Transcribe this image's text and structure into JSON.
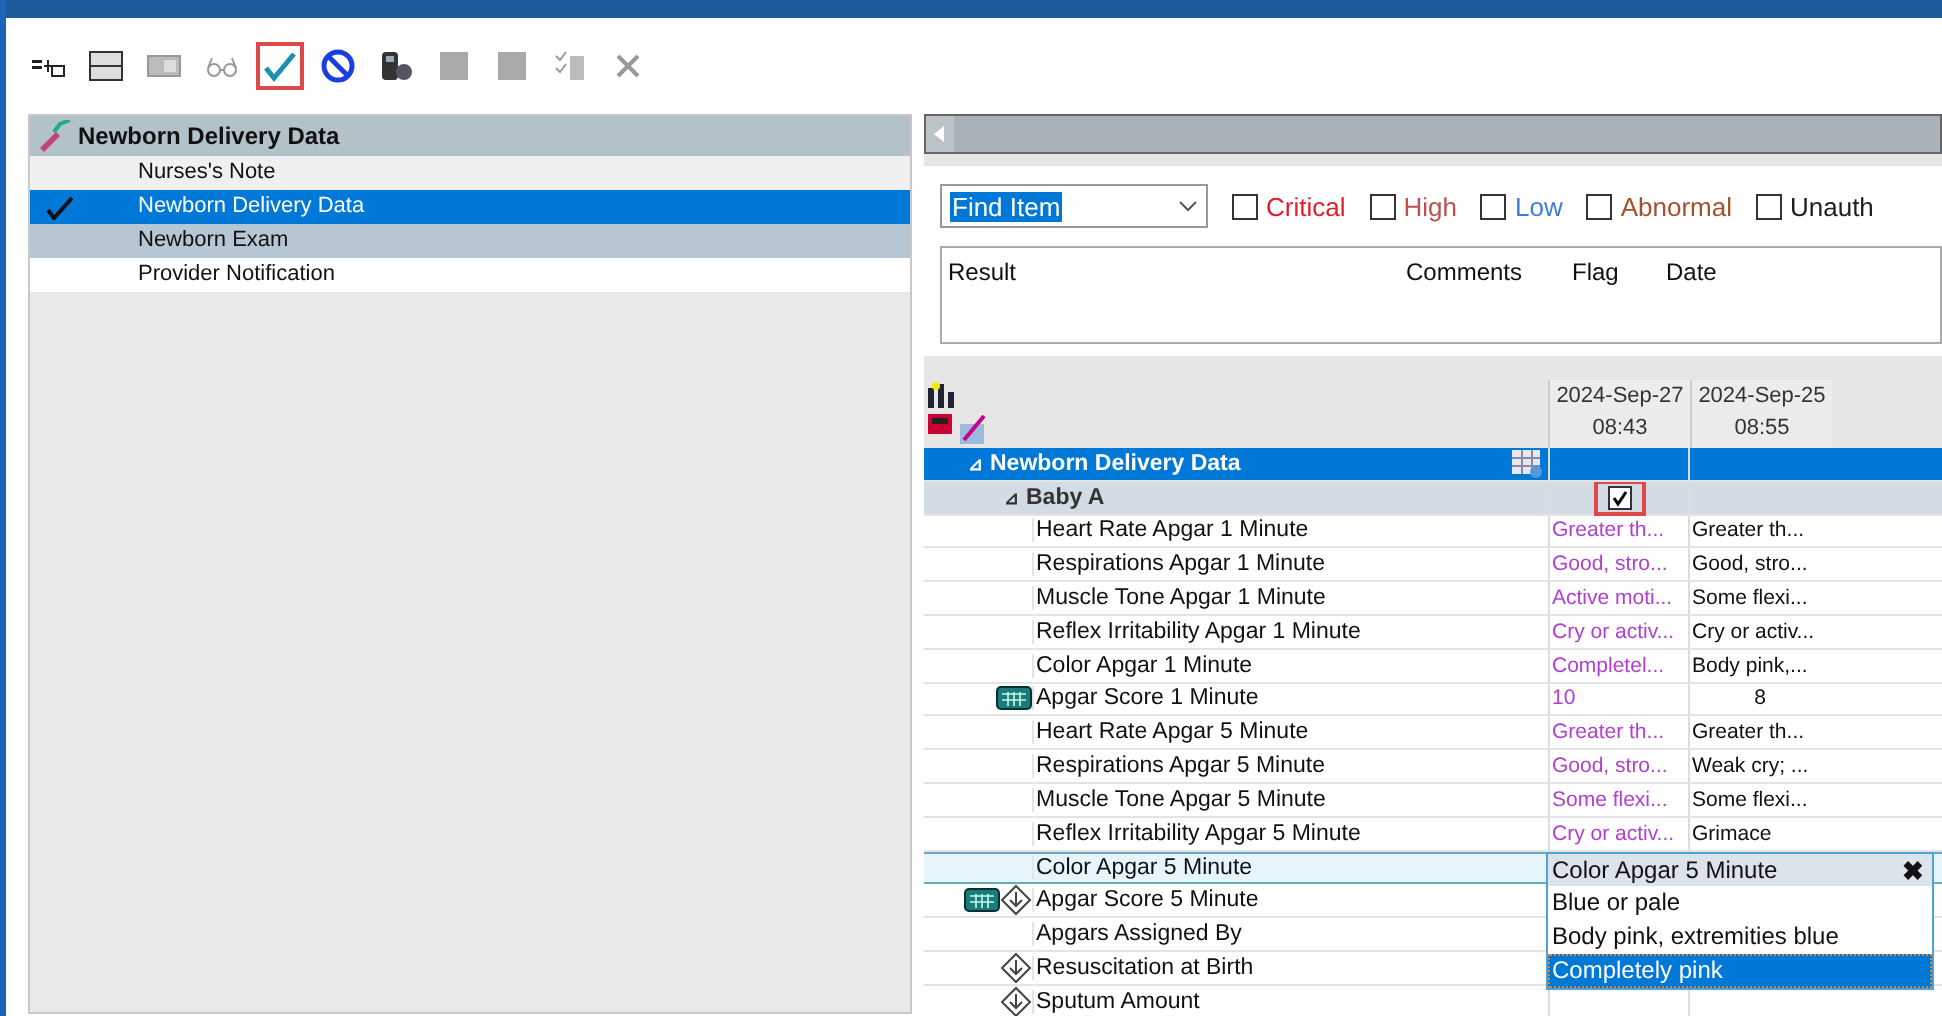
{
  "toolbar": [
    {
      "kind": "flow",
      "highlighted": false
    },
    {
      "kind": "split",
      "highlighted": false
    },
    {
      "kind": "form",
      "highlighted": false
    },
    {
      "kind": "glasses",
      "highlighted": false
    },
    {
      "kind": "check",
      "highlighted": true
    },
    {
      "kind": "block",
      "highlighted": false
    },
    {
      "kind": "device",
      "highlighted": false
    },
    {
      "kind": "gray",
      "highlighted": false
    },
    {
      "kind": "gray",
      "highlighted": false
    },
    {
      "kind": "list",
      "highlighted": false
    },
    {
      "kind": "close",
      "highlighted": false
    }
  ],
  "form_list": {
    "title": "Newborn Delivery Data",
    "items": [
      {
        "label": "Nurses's Note",
        "selected": false,
        "done": false
      },
      {
        "label": "Newborn Delivery Data",
        "selected": true,
        "done": true
      },
      {
        "label": "Newborn Exam",
        "selected": false,
        "done": false
      },
      {
        "label": "Provider Notification",
        "selected": false,
        "done": false
      }
    ]
  },
  "filter": {
    "find": "Find Item",
    "checks": [
      {
        "label": "Critical",
        "checked": false,
        "color": "#e0202a"
      },
      {
        "label": "High",
        "checked": false,
        "color": "#c0504d"
      },
      {
        "label": "Low",
        "checked": false,
        "color": "#3a7fd5"
      },
      {
        "label": "Abnormal",
        "checked": false,
        "color": "#a0522d"
      },
      {
        "label": "Unauth",
        "checked": false,
        "color": "#202020"
      }
    ]
  },
  "results": {
    "columns": [
      "Result",
      "Comments",
      "Flag",
      "Date"
    ]
  },
  "grid": {
    "columns": [
      {
        "date": "2024-Sep-27",
        "time": "08:43"
      },
      {
        "date": "2024-Sep-25",
        "time": "08:55"
      }
    ],
    "section": "Newborn Delivery Data",
    "section_expander": "⊿",
    "group": {
      "expander": "⊿",
      "label": "Baby A",
      "checked": true,
      "highlighted": true
    },
    "rows": [
      {
        "label": "Heart Rate Apgar 1 Minute",
        "calculated": false,
        "linked": false,
        "selected": false,
        "values": [
          {
            "text": "Greater th...",
            "pending": true
          },
          {
            "text": "Greater th...",
            "pending": false
          }
        ]
      },
      {
        "label": "Respirations Apgar 1 Minute",
        "calculated": false,
        "linked": false,
        "selected": false,
        "values": [
          {
            "text": "Good, stro...",
            "pending": true
          },
          {
            "text": "Good, stro...",
            "pending": false
          }
        ]
      },
      {
        "label": "Muscle Tone Apgar 1 Minute",
        "calculated": false,
        "linked": false,
        "selected": false,
        "values": [
          {
            "text": "Active moti...",
            "pending": true
          },
          {
            "text": "Some flexi...",
            "pending": false
          }
        ]
      },
      {
        "label": "Reflex Irritability Apgar 1 Minute",
        "calculated": false,
        "linked": false,
        "selected": false,
        "values": [
          {
            "text": "Cry or activ...",
            "pending": true
          },
          {
            "text": "Cry or activ...",
            "pending": false
          }
        ]
      },
      {
        "label": "Color Apgar 1 Minute",
        "calculated": false,
        "linked": false,
        "selected": false,
        "values": [
          {
            "text": "Completel...",
            "pending": true
          },
          {
            "text": "Body pink,...",
            "pending": false
          }
        ]
      },
      {
        "label": "Apgar Score 1 Minute",
        "calculated": true,
        "linked": false,
        "selected": false,
        "values": [
          {
            "text": "10",
            "pending": true
          },
          {
            "text": "8",
            "pending": false
          }
        ]
      },
      {
        "label": "Heart Rate Apgar 5 Minute",
        "calculated": false,
        "linked": false,
        "selected": false,
        "values": [
          {
            "text": "Greater th...",
            "pending": true
          },
          {
            "text": "Greater th...",
            "pending": false
          }
        ]
      },
      {
        "label": "Respirations Apgar 5 Minute",
        "calculated": false,
        "linked": false,
        "selected": false,
        "values": [
          {
            "text": "Good, stro...",
            "pending": true
          },
          {
            "text": "Weak cry; ...",
            "pending": false
          }
        ]
      },
      {
        "label": "Muscle Tone Apgar 5 Minute",
        "calculated": false,
        "linked": false,
        "selected": false,
        "values": [
          {
            "text": "Some flexi...",
            "pending": true
          },
          {
            "text": "Some flexi...",
            "pending": false
          }
        ]
      },
      {
        "label": "Reflex Irritability Apgar 5 Minute",
        "calculated": false,
        "linked": false,
        "selected": false,
        "values": [
          {
            "text": "Cry or activ...",
            "pending": true
          },
          {
            "text": "Grimace",
            "pending": false
          }
        ]
      },
      {
        "label": "Color Apgar 5 Minute",
        "calculated": false,
        "linked": false,
        "selected": true,
        "values": []
      },
      {
        "label": "Apgar Score 5 Minute",
        "calculated": true,
        "linked": true,
        "selected": false,
        "values": []
      },
      {
        "label": "Apgars Assigned By",
        "calculated": false,
        "linked": false,
        "selected": false,
        "values": []
      },
      {
        "label": "Resuscitation at Birth",
        "calculated": false,
        "linked": true,
        "selected": false,
        "values": []
      },
      {
        "label": "Sputum Amount",
        "calculated": false,
        "linked": true,
        "selected": false,
        "values": []
      }
    ]
  },
  "popup": {
    "title": "Color Apgar 5 Minute",
    "close": "✖",
    "options": [
      {
        "label": "Blue or pale",
        "selected": false
      },
      {
        "label": "Body pink, extremities blue",
        "selected": false
      },
      {
        "label": "Completely pink",
        "selected": true
      }
    ]
  }
}
